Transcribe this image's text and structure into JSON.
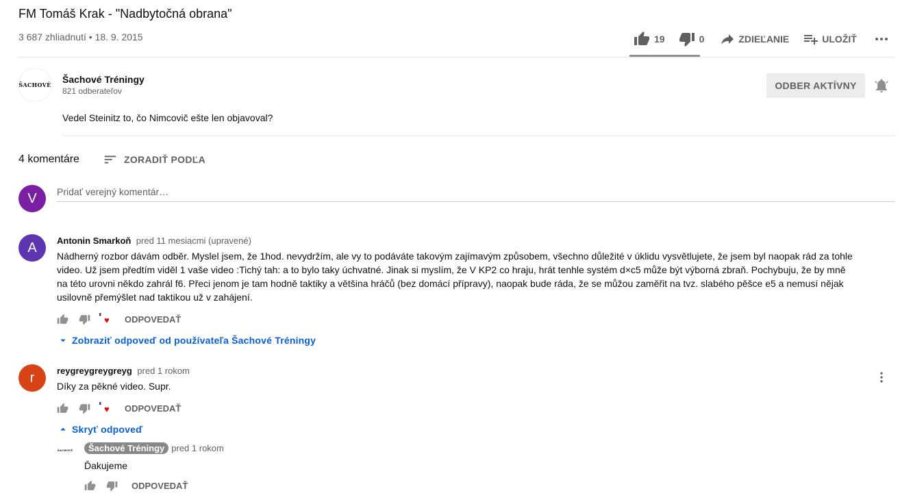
{
  "video": {
    "title": "FM Tomáš Krak - \"Nadbytočná obrana\"",
    "meta": "3 687 zhliadnutí • 18. 9. 2015",
    "likes": "19",
    "dislikes": "0",
    "share_label": "ZDIEĽANIE",
    "save_label": "ULOŽIŤ",
    "like_ratio": 1.0
  },
  "channel": {
    "logo_text": "ŠACHOVÉ",
    "name": "Šachové Tréningy",
    "subs": "821 odberateľov",
    "subscribe_label": "ODBER AKTÍVNY",
    "description": "Vedel Steinitz to, čo Nimcovič ešte len objavoval?"
  },
  "comments_header": {
    "count": "4 komentáre",
    "sort_label": "ZORADIŤ PODĽA",
    "add_placeholder": "Pridať verejný komentár…",
    "user_initial": "V",
    "user_color": "#7b1fa2"
  },
  "comments": [
    {
      "initial": "A",
      "color": "#5e35b1",
      "author": "Antonin Smarkoň",
      "time": "pred 11 mesiacmi (upravené)",
      "lines": [
        "Nádherný rozbor dávám odběr. Myslel jsem, že 1hod. nevydržím, ale vy to podáváte takovým zajímavým způsobem, všechno důležité v úklidu vysvětlujete, že jsem byl naopak rád za tohle",
        "video. Už jsem předtím viděl 1 vaše video :Tichý tah: a to bylo taky úchvatné. Jinak si myslím, že V KP2 co hraju, hrát tenhle systém d×c5 může být výborná zbraň. Pochybuju, že by mně",
        "na této urovni někdo zahrál f6. Přeci jenom je tam hodně taktiky a většina hráčů (bez domácí přípravy), naopak bude ráda, že se můžou zaměřit na tvz. slabého pěšce e5 a nemusí nějak",
        "usilovně přemýšlet nad taktikou už v zahájení."
      ],
      "reply_label": "ODPOVEDAŤ",
      "replies_toggle": "Zobraziť odpoveď od používateľa Šachové Tréningy"
    },
    {
      "initial": "r",
      "color": "#d84315",
      "author": "reygreygreygreyg",
      "time": "pred 1 rokom",
      "text": "Díky za pěkné video. Supr.",
      "reply_label": "ODPOVEDAŤ",
      "replies_toggle": "Skryť odpoveď"
    }
  ],
  "reply": {
    "logo_text": "ŠACHOVÉ",
    "author": "Šachové Tréningy",
    "time": "pred 1 rokom",
    "text": "Ďakujeme",
    "reply_label": "ODPOVEDAŤ"
  },
  "icons": {
    "like": "thumb-up-icon",
    "dislike": "thumb-down-icon",
    "share": "share-icon",
    "save": "playlist-add-icon",
    "more": "more-horiz-icon",
    "bell": "bell-icon",
    "sort": "sort-icon",
    "heart": "heart-icon",
    "chevron_down": "chevron-down-icon",
    "chevron_up": "chevron-up-icon",
    "kebab": "more-vert-icon"
  }
}
